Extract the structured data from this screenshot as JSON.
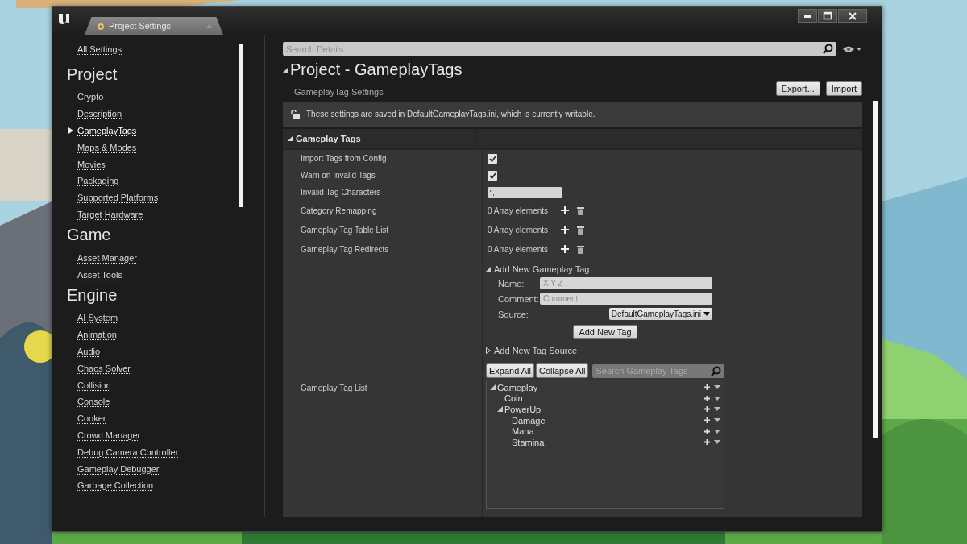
{
  "window": {
    "tab_title": "Project Settings"
  },
  "sidebar": {
    "top_link": "All Settings",
    "sections": [
      {
        "title": "Project",
        "items": [
          {
            "label": "Crypto",
            "selected": false
          },
          {
            "label": "Description",
            "selected": false
          },
          {
            "label": "GameplayTags",
            "selected": true
          },
          {
            "label": "Maps & Modes",
            "selected": false
          },
          {
            "label": "Movies",
            "selected": false
          },
          {
            "label": "Packaging",
            "selected": false
          },
          {
            "label": "Supported Platforms",
            "selected": false
          },
          {
            "label": "Target Hardware",
            "selected": false
          }
        ]
      },
      {
        "title": "Game",
        "items": [
          {
            "label": "Asset Manager",
            "selected": false
          },
          {
            "label": "Asset Tools",
            "selected": false
          }
        ]
      },
      {
        "title": "Engine",
        "items": [
          {
            "label": "AI System",
            "selected": false
          },
          {
            "label": "Animation",
            "selected": false
          },
          {
            "label": "Audio",
            "selected": false
          },
          {
            "label": "Chaos Solver",
            "selected": false
          },
          {
            "label": "Collision",
            "selected": false
          },
          {
            "label": "Console",
            "selected": false
          },
          {
            "label": "Cooker",
            "selected": false
          },
          {
            "label": "Crowd Manager",
            "selected": false
          },
          {
            "label": "Debug Camera Controller",
            "selected": false
          },
          {
            "label": "Gameplay Debugger",
            "selected": false
          },
          {
            "label": "Garbage Collection",
            "selected": false
          }
        ]
      }
    ]
  },
  "details": {
    "search": {
      "placeholder": "Search Details"
    },
    "title": "Project - GameplayTags",
    "subtitle": "GameplayTag Settings",
    "buttons": [
      "Export...",
      "Import"
    ],
    "notice": "These settings are saved in DefaultGameplayTags.ini, which is currently writable.",
    "category": {
      "title": "Gameplay Tags",
      "expanded": true
    },
    "properties": [
      {
        "kind": "checkbox",
        "label": "Import Tags from Config",
        "checked": true
      },
      {
        "kind": "checkbox",
        "label": "Warn on Invalid Tags",
        "checked": true
      },
      {
        "kind": "text",
        "label": "Invalid Tag Characters",
        "value": "\","
      },
      {
        "kind": "array",
        "label": "Category Remapping",
        "value": "0 Array elements"
      },
      {
        "kind": "array",
        "label": "Gameplay Tag Table List",
        "value": "0 Array elements"
      },
      {
        "kind": "array",
        "label": "Gameplay Tag Redirects",
        "value": "0 Array elements"
      }
    ],
    "tag_list": {
      "label": "Gameplay Tag List",
      "add_tag": {
        "title": "Add New Gameplay Tag",
        "expanded": true,
        "fields": [
          {
            "label": "Name:",
            "placeholder": "X Y Z"
          },
          {
            "label": "Comment:",
            "placeholder": "Comment"
          }
        ],
        "source": {
          "label": "Source:",
          "value": "DefaultGameplayTags.ini"
        },
        "button": "Add New Tag"
      },
      "add_source": {
        "title": "Add New Tag Source",
        "expanded": false
      },
      "buttons": [
        "Expand All",
        "Collapse All"
      ],
      "search": {
        "placeholder": "Search Gameplay Tags"
      },
      "tags": [
        {
          "label": "Gameplay",
          "expanded": true,
          "children": [
            {
              "label": "Coin"
            },
            {
              "label": "PowerUp",
              "expanded": true,
              "children": [
                {
                  "label": "Damage"
                },
                {
                  "label": "Mana"
                },
                {
                  "label": "Stamina"
                }
              ]
            }
          ]
        }
      ]
    }
  }
}
